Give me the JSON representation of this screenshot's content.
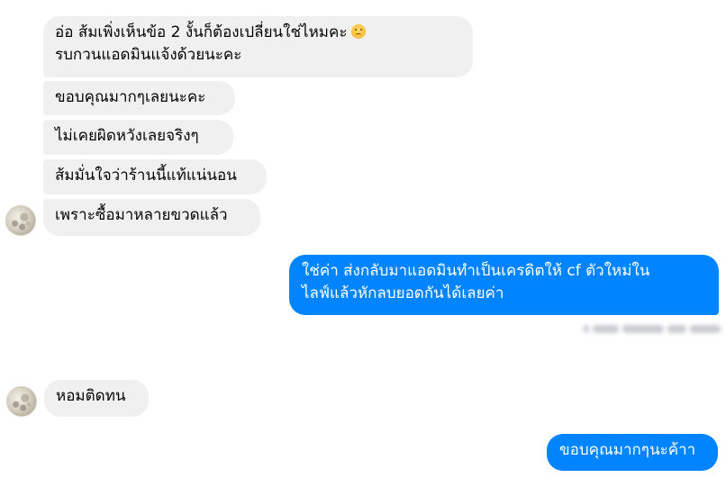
{
  "messages": {
    "incoming": [
      {
        "line1": "อ่อ ส้มเพิ่งเห็นข้อ 2 งั้นก็ต้องเปลี่ยนใช่ไหมคะ",
        "emoji": "sad-face-emoji",
        "line2": "รบกวนแอดมินแจ้งด้วยนะคะ"
      },
      {
        "text": "ขอบคุณมากๆเลยนะคะ"
      },
      {
        "text": "ไม่เคยผิดหวังเลยจริงๆ"
      },
      {
        "text": "ส้มมั่นใจว่าร้านนี้แท้แน่นอน"
      },
      {
        "text": "เพราะซื้อมาหลายขวดแล้ว"
      },
      {
        "text": "หอมติดทน"
      }
    ],
    "outgoing": [
      {
        "line1": "ใช่ค่า ส่งกลับมาแอดมินทำเป็นเครดิตให้ cf ตัวใหม่ใน",
        "line2": "ไลฟ์แล้วหักลบยอดกันได้เลยค่า"
      },
      {
        "text": "ขอบคุณมากๆนะค้าา"
      }
    ]
  },
  "colors": {
    "incoming_bubble": "#f0f0f0",
    "outgoing_bubble": "#0084ff",
    "incoming_text": "#050505",
    "outgoing_text": "#ffffff"
  }
}
